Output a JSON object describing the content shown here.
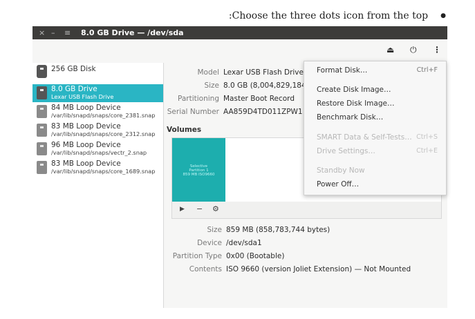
{
  "caption": {
    "text": ":Choose the three dots icon from the top",
    "bullet": "●"
  },
  "window": {
    "controls": {
      "close": "×",
      "minimize": "–",
      "menu": "≡"
    },
    "title": "8.0 GB Drive — /dev/sda"
  },
  "headerbar": {
    "eject_icon": "⏏",
    "power_icon": "⏻",
    "menu_icon": "⋮"
  },
  "sidebar": {
    "devices": [
      {
        "name": "256 GB Disk",
        "sub": ""
      },
      {
        "name": "8.0 GB Drive",
        "sub": "Lexar USB Flash Drive"
      },
      {
        "name": "84 MB Loop Device",
        "sub": "/var/lib/snapd/snaps/core_2381.snap"
      },
      {
        "name": "83 MB Loop Device",
        "sub": "/var/lib/snapd/snaps/core_2312.snap"
      },
      {
        "name": "96 MB Loop Device",
        "sub": "/var/lib/snapd/snaps/vectr_2.snap"
      },
      {
        "name": "83 MB Loop Device",
        "sub": "/var/lib/snapd/snaps/core_1689.snap"
      }
    ]
  },
  "drive": {
    "model_label": "Model",
    "model_value": "Lexar USB Flash Drive (",
    "size_label": "Size",
    "size_value": "8.0 GB (8,004,829,184 by",
    "partitioning_label": "Partitioning",
    "partitioning_value": "Master Boot Record",
    "serial_label": "Serial Number",
    "serial_value": "AA859D4TD011ZPW1"
  },
  "volumes": {
    "heading": "Volumes",
    "partition": {
      "line1": "Selective",
      "line2": "Partition 1",
      "line3": "859 MB ISO9660"
    },
    "toolbar": {
      "play": "▶",
      "minus": "−",
      "gears": "⚙"
    }
  },
  "partition": {
    "size_label": "Size",
    "size_value": "859 MB (858,783,744 bytes)",
    "device_label": "Device",
    "device_value": "/dev/sda1",
    "type_label": "Partition Type",
    "type_value": "0x00 (Bootable)",
    "contents_label": "Contents",
    "contents_value": "ISO 9660 (version Joliet Extension) — Not Mounted"
  },
  "menu": {
    "format": {
      "label": "Format Disk…",
      "accel": "Ctrl+F"
    },
    "create_image": {
      "label": "Create Disk Image…"
    },
    "restore_image": {
      "label": "Restore Disk Image…"
    },
    "benchmark": {
      "label": "Benchmark Disk…"
    },
    "smart": {
      "label": "SMART Data & Self-Tests…",
      "accel": "Ctrl+S"
    },
    "settings": {
      "label": "Drive Settings…",
      "accel": "Ctrl+E"
    },
    "standby": {
      "label": "Standby Now"
    },
    "power_off": {
      "label": "Power Off…"
    }
  }
}
